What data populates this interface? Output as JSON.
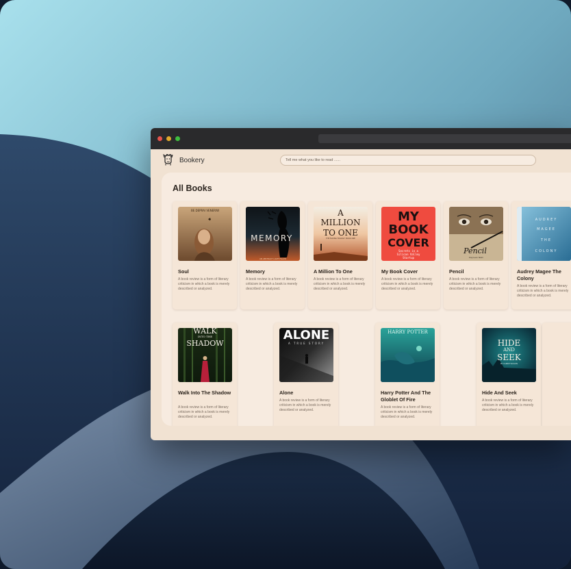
{
  "app": {
    "name": "Bookery",
    "search_placeholder": "Tell me what you like to read ......"
  },
  "section": {
    "title": "All Books"
  },
  "books": [
    {
      "title": "Soul",
      "description": "A book review is a form of literary criticism in which a book is merely described or analyzed.",
      "cover_text": [
        "BE DEPRAI VENERIW"
      ]
    },
    {
      "title": "Memory",
      "description": "A book review is a form of literary criticism in which a book is merely described or analyzed.",
      "cover_text": [
        "MEMORY",
        "AN ABSTRACT LIGHT-FILLED"
      ]
    },
    {
      "title": "A Million To One",
      "description": "A book review is a form of literary criticism in which a book is merely described or analyzed.",
      "cover_text": [
        "A",
        "MILLION",
        "TO ONE",
        "THE FADING TRILOGY: BOOK ONE"
      ]
    },
    {
      "title": "My Book Cover",
      "description": "A book review is a form of literary criticism in which a book is merely described or analyzed.",
      "cover_text": [
        "MY",
        "BOOK",
        "COVER",
        "Secrets in a",
        "Silicon Valley",
        "Startup"
      ]
    },
    {
      "title": "Pencil",
      "description": "A book review is a form of literary criticism in which a book is merely described or analyzed.",
      "cover_text": [
        "Pencil",
        "Daji Leon Nishi"
      ]
    },
    {
      "title": "Audrey Magee The Colony",
      "description": "A book review is a form of literary criticism in which a book is merely described or analyzed.",
      "cover_text": [
        "AUDREY",
        "MAGEE",
        "THE",
        "COLONY"
      ]
    },
    {
      "title": "Walk Into The Shadow",
      "description": "A book review is a form of literary criticism in which a book is merely described or analyzed.",
      "cover_text": [
        "WALK",
        "INTO THE",
        "SHADOW"
      ]
    },
    {
      "title": "Alone",
      "description": "A book review is a form of literary criticism in which a book is merely described or analyzed.",
      "cover_text": [
        "ALONE",
        "A TRUE STORY"
      ]
    },
    {
      "title": "Harry Potter And The Globlet Of Fire",
      "description": "A book review is a form of literary criticism in which a book is merely described or analyzed.",
      "cover_text": [
        "HARRY POTTER"
      ]
    },
    {
      "title": "Hide And Seek",
      "description": "A book review is a form of literary criticism in which a book is merely described or analyzed.",
      "cover_text": [
        "HIDE",
        "AND",
        "SEEK",
        "BY CARRIE WILSON"
      ]
    }
  ],
  "colors": {
    "window_chrome": "#2a2a2c",
    "app_background": "#f1e2d2",
    "panel_background": "#f7ebe0",
    "card_background": "#f5e6d7",
    "traffic_lights": [
      "#e5534b",
      "#e0a92c",
      "#3fbf3f"
    ]
  },
  "icons": [
    "face-logo-icon"
  ]
}
